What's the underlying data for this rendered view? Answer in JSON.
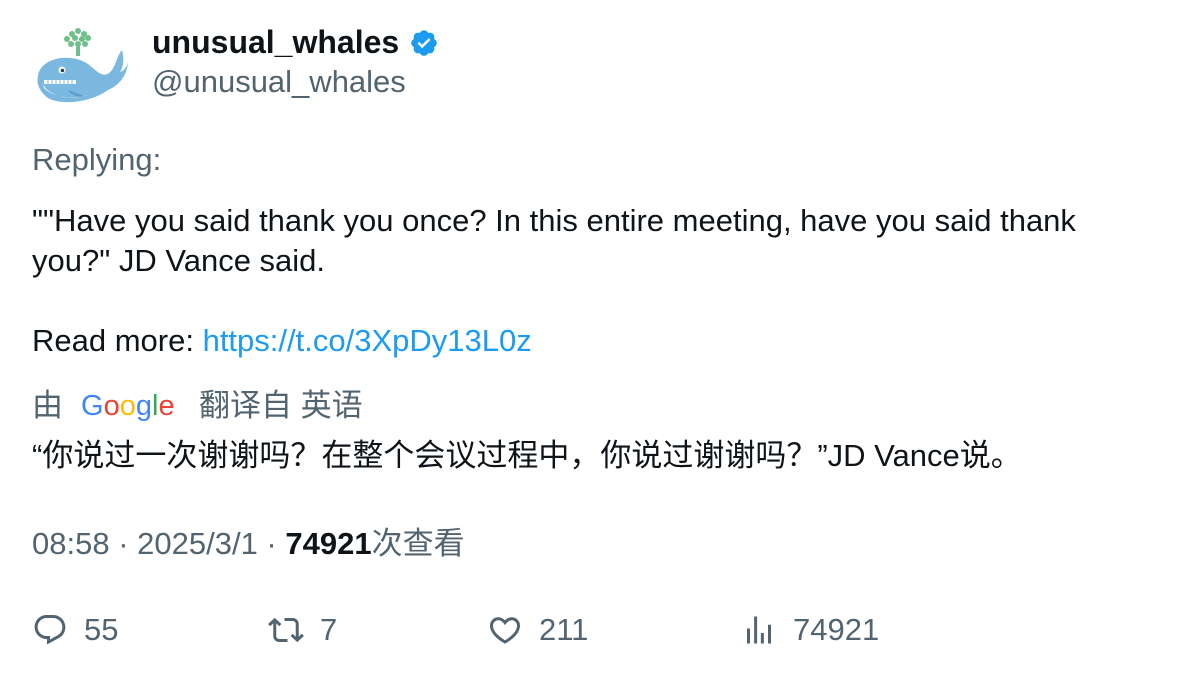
{
  "author": {
    "display_name": "unusual_whales",
    "handle": "@unusual_whales",
    "verified": true,
    "avatar_icon": "whale-avatar"
  },
  "tweet": {
    "replying_label": "Replying:",
    "text": "\"\"Have you said thank you once? In this entire meeting, have you said thank you?\" JD Vance said.",
    "read_more_label": "Read more: ",
    "link": "https://t.co/3XpDy13L0z"
  },
  "translation": {
    "by_label": "由",
    "provider": "Google",
    "from_label": "翻译自 英语",
    "text": "“你说过一次谢谢吗？在整个会议过程中，你说过谢谢吗？”JD Vance说。"
  },
  "meta": {
    "time": "08:58",
    "separator": " · ",
    "date": "2025/3/1",
    "views": "74921",
    "views_suffix": "次查看"
  },
  "actions": {
    "replies": "55",
    "retweets": "7",
    "likes": "211",
    "views": "74921"
  },
  "colors": {
    "link": "#1d9bf0",
    "secondary_text": "#536471",
    "primary_text": "#0f1419",
    "verified": "#1d9bf0"
  }
}
